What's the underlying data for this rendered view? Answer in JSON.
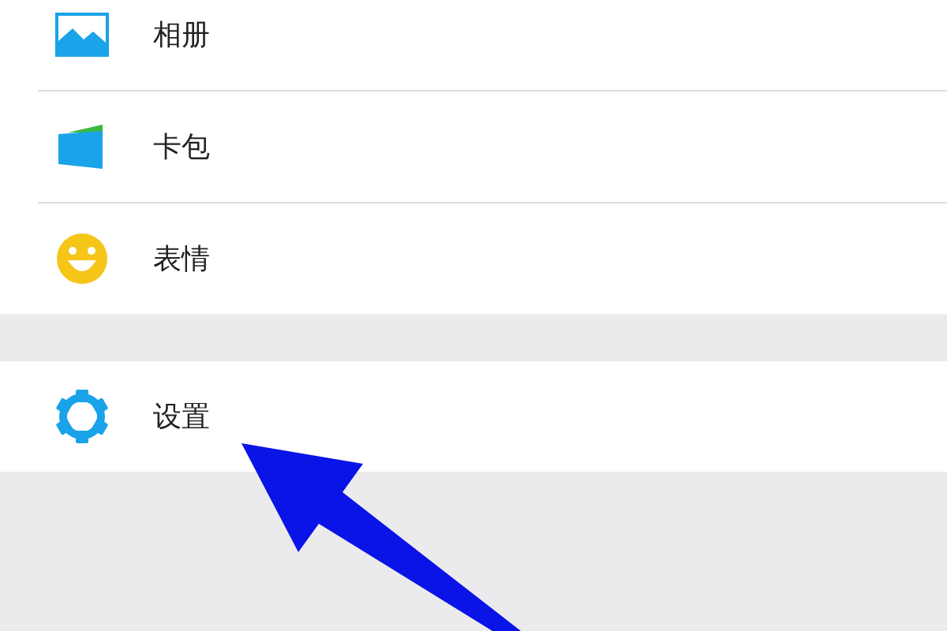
{
  "groups": [
    {
      "items": [
        {
          "kind": "album",
          "label": "相册"
        },
        {
          "kind": "cards",
          "label": "卡包"
        },
        {
          "kind": "stickers",
          "label": "表情"
        }
      ]
    },
    {
      "items": [
        {
          "kind": "settings",
          "label": "设置"
        }
      ]
    }
  ],
  "annotation": {
    "kind": "arrow"
  }
}
